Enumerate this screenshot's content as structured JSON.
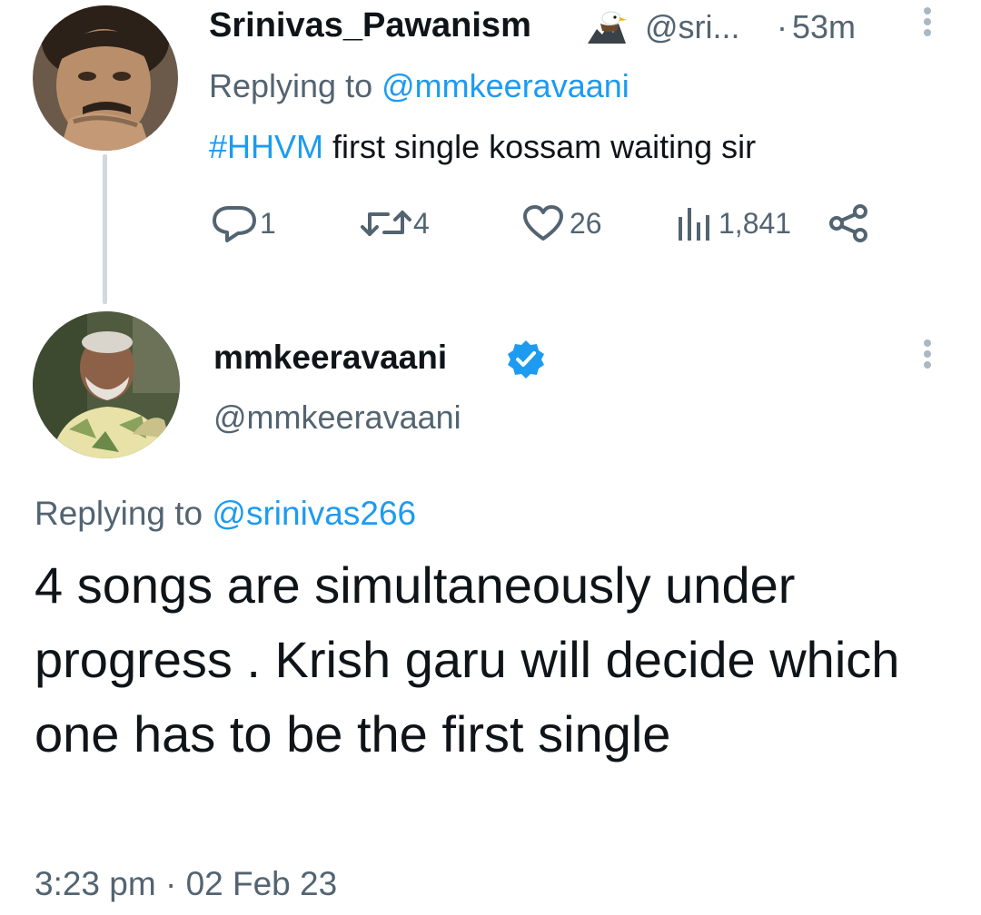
{
  "reply_tweet": {
    "author_name": "Srinivas_Pawanism",
    "author_badge_icon": "eagle-icon",
    "author_handle": "@sri...",
    "separator": "·",
    "time_ago": "53m",
    "replying_prefix": "Replying to",
    "replying_to": "@mmkeeravaani",
    "hashtag": "#HHVM",
    "text": " first single kossam waiting sir",
    "actions": {
      "replies": "1",
      "retweets": "4",
      "likes": "26",
      "views": "1,841"
    }
  },
  "main_tweet": {
    "author_name": "mmkeeravaani",
    "verified": true,
    "author_handle": "@mmkeeravaani",
    "replying_prefix": "Replying to",
    "replying_to": "@srinivas266",
    "text": "4 songs are simultaneously under progress . Krish garu will decide which one has to be the first single",
    "timestamp": "3:23 pm · 02 Feb 23"
  },
  "colors": {
    "link": "#1d9bf0",
    "secondary_text": "#536471",
    "primary_text": "#0f1419",
    "thread_line": "#cfd9de"
  }
}
